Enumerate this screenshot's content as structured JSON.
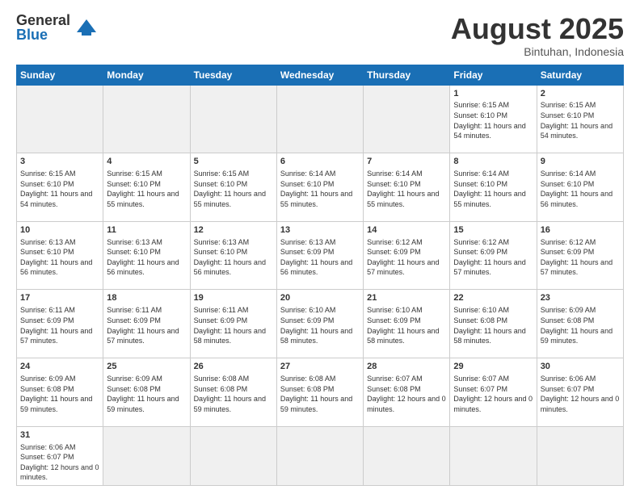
{
  "logo": {
    "general": "General",
    "blue": "Blue"
  },
  "title": "August 2025",
  "location": "Bintuhan, Indonesia",
  "days_of_week": [
    "Sunday",
    "Monday",
    "Tuesday",
    "Wednesday",
    "Thursday",
    "Friday",
    "Saturday"
  ],
  "weeks": [
    [
      {
        "day": "",
        "empty": true
      },
      {
        "day": "",
        "empty": true
      },
      {
        "day": "",
        "empty": true
      },
      {
        "day": "",
        "empty": true
      },
      {
        "day": "",
        "empty": true
      },
      {
        "day": "1",
        "sunrise": "6:15 AM",
        "sunset": "6:10 PM",
        "daylight": "11 hours and 54 minutes."
      },
      {
        "day": "2",
        "sunrise": "6:15 AM",
        "sunset": "6:10 PM",
        "daylight": "11 hours and 54 minutes."
      }
    ],
    [
      {
        "day": "3",
        "sunrise": "6:15 AM",
        "sunset": "6:10 PM",
        "daylight": "11 hours and 54 minutes."
      },
      {
        "day": "4",
        "sunrise": "6:15 AM",
        "sunset": "6:10 PM",
        "daylight": "11 hours and 55 minutes."
      },
      {
        "day": "5",
        "sunrise": "6:15 AM",
        "sunset": "6:10 PM",
        "daylight": "11 hours and 55 minutes."
      },
      {
        "day": "6",
        "sunrise": "6:14 AM",
        "sunset": "6:10 PM",
        "daylight": "11 hours and 55 minutes."
      },
      {
        "day": "7",
        "sunrise": "6:14 AM",
        "sunset": "6:10 PM",
        "daylight": "11 hours and 55 minutes."
      },
      {
        "day": "8",
        "sunrise": "6:14 AM",
        "sunset": "6:10 PM",
        "daylight": "11 hours and 55 minutes."
      },
      {
        "day": "9",
        "sunrise": "6:14 AM",
        "sunset": "6:10 PM",
        "daylight": "11 hours and 56 minutes."
      }
    ],
    [
      {
        "day": "10",
        "sunrise": "6:13 AM",
        "sunset": "6:10 PM",
        "daylight": "11 hours and 56 minutes."
      },
      {
        "day": "11",
        "sunrise": "6:13 AM",
        "sunset": "6:10 PM",
        "daylight": "11 hours and 56 minutes."
      },
      {
        "day": "12",
        "sunrise": "6:13 AM",
        "sunset": "6:10 PM",
        "daylight": "11 hours and 56 minutes."
      },
      {
        "day": "13",
        "sunrise": "6:13 AM",
        "sunset": "6:09 PM",
        "daylight": "11 hours and 56 minutes."
      },
      {
        "day": "14",
        "sunrise": "6:12 AM",
        "sunset": "6:09 PM",
        "daylight": "11 hours and 57 minutes."
      },
      {
        "day": "15",
        "sunrise": "6:12 AM",
        "sunset": "6:09 PM",
        "daylight": "11 hours and 57 minutes."
      },
      {
        "day": "16",
        "sunrise": "6:12 AM",
        "sunset": "6:09 PM",
        "daylight": "11 hours and 57 minutes."
      }
    ],
    [
      {
        "day": "17",
        "sunrise": "6:11 AM",
        "sunset": "6:09 PM",
        "daylight": "11 hours and 57 minutes."
      },
      {
        "day": "18",
        "sunrise": "6:11 AM",
        "sunset": "6:09 PM",
        "daylight": "11 hours and 57 minutes."
      },
      {
        "day": "19",
        "sunrise": "6:11 AM",
        "sunset": "6:09 PM",
        "daylight": "11 hours and 58 minutes."
      },
      {
        "day": "20",
        "sunrise": "6:10 AM",
        "sunset": "6:09 PM",
        "daylight": "11 hours and 58 minutes."
      },
      {
        "day": "21",
        "sunrise": "6:10 AM",
        "sunset": "6:09 PM",
        "daylight": "11 hours and 58 minutes."
      },
      {
        "day": "22",
        "sunrise": "6:10 AM",
        "sunset": "6:08 PM",
        "daylight": "11 hours and 58 minutes."
      },
      {
        "day": "23",
        "sunrise": "6:09 AM",
        "sunset": "6:08 PM",
        "daylight": "11 hours and 59 minutes."
      }
    ],
    [
      {
        "day": "24",
        "sunrise": "6:09 AM",
        "sunset": "6:08 PM",
        "daylight": "11 hours and 59 minutes."
      },
      {
        "day": "25",
        "sunrise": "6:09 AM",
        "sunset": "6:08 PM",
        "daylight": "11 hours and 59 minutes."
      },
      {
        "day": "26",
        "sunrise": "6:08 AM",
        "sunset": "6:08 PM",
        "daylight": "11 hours and 59 minutes."
      },
      {
        "day": "27",
        "sunrise": "6:08 AM",
        "sunset": "6:08 PM",
        "daylight": "11 hours and 59 minutes."
      },
      {
        "day": "28",
        "sunrise": "6:07 AM",
        "sunset": "6:08 PM",
        "daylight": "12 hours and 0 minutes."
      },
      {
        "day": "29",
        "sunrise": "6:07 AM",
        "sunset": "6:07 PM",
        "daylight": "12 hours and 0 minutes."
      },
      {
        "day": "30",
        "sunrise": "6:06 AM",
        "sunset": "6:07 PM",
        "daylight": "12 hours and 0 minutes."
      }
    ],
    [
      {
        "day": "31",
        "sunrise": "6:06 AM",
        "sunset": "6:07 PM",
        "daylight": "12 hours and 0 minutes."
      },
      {
        "day": "",
        "empty": true
      },
      {
        "day": "",
        "empty": true
      },
      {
        "day": "",
        "empty": true
      },
      {
        "day": "",
        "empty": true
      },
      {
        "day": "",
        "empty": true
      },
      {
        "day": "",
        "empty": true
      }
    ]
  ],
  "sunrise_label": "Sunrise:",
  "sunset_label": "Sunset:",
  "daylight_label": "Daylight:"
}
